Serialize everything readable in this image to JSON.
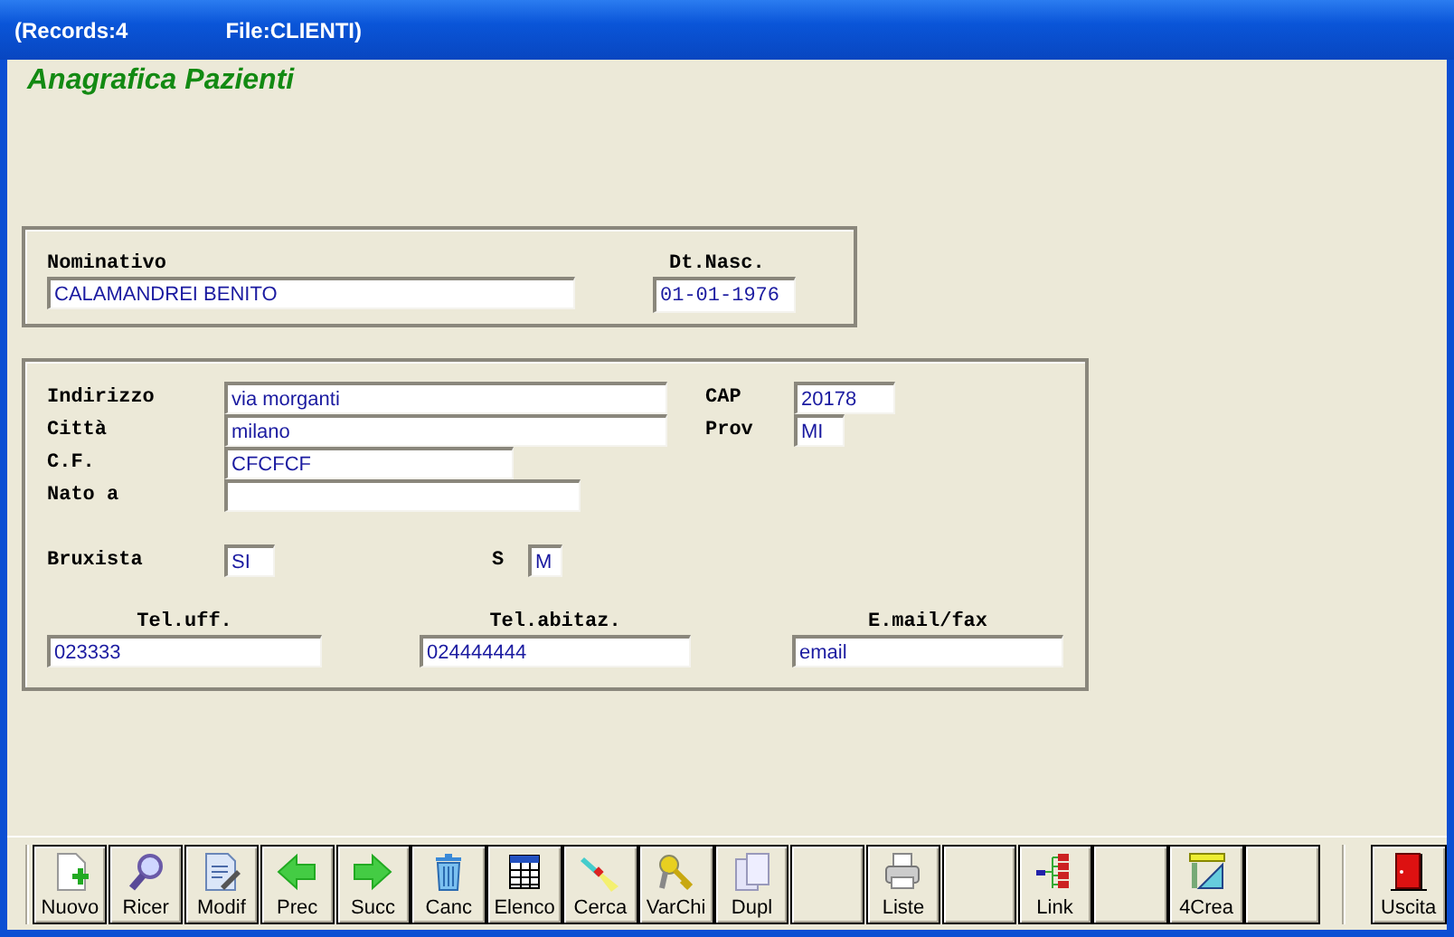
{
  "window": {
    "title_records": "(Records:4",
    "title_file": "File:CLIENTI)"
  },
  "form_title": "Anagrafica Pazienti",
  "name_panel": {
    "fields": [
      {
        "label": "Nominativo",
        "value": "CALAMANDREI BENITO"
      },
      {
        "label": "Dt.Nasc.",
        "value": "01-01-1976"
      }
    ]
  },
  "address_panel": {
    "fields": [
      {
        "label": "Indirizzo",
        "value": "via morganti"
      },
      {
        "label": "CAP",
        "value": "20178"
      },
      {
        "label": "Città",
        "value": "milano"
      },
      {
        "label": "Prov",
        "value": "MI"
      },
      {
        "label": "C.F.",
        "value": "CFCFCF"
      },
      {
        "label": "Nato a"
      },
      {
        "label": "Bruxista",
        "value": "SI"
      },
      {
        "label": "S",
        "value": "M"
      },
      {
        "label": "Tel.uff.",
        "value": "023333"
      },
      {
        "label": "Tel.abitaz.",
        "value": "024444444"
      },
      {
        "label": "E.mail/fax",
        "value": "email"
      }
    ]
  },
  "toolbar": [
    {
      "kind": "new",
      "label": "Nuovo"
    },
    {
      "kind": "search",
      "label": "Ricer"
    },
    {
      "kind": "edit",
      "label": "Modif"
    },
    {
      "kind": "prev",
      "label": "Prec"
    },
    {
      "kind": "next",
      "label": "Succ"
    },
    {
      "kind": "delete",
      "label": "Canc"
    },
    {
      "kind": "list",
      "label": "Elenco"
    },
    {
      "kind": "find",
      "label": "Cerca"
    },
    {
      "kind": "keys",
      "label": "VarChi"
    },
    {
      "kind": "duplicate",
      "label": "Dupl"
    },
    {
      "kind": "blank"
    },
    {
      "kind": "print",
      "label": "Liste"
    },
    {
      "kind": "blank"
    },
    {
      "kind": "link",
      "label": "Link"
    },
    {
      "kind": "blank"
    },
    {
      "kind": "create",
      "label": "4Crea"
    },
    {
      "kind": "blank"
    },
    {
      "kind": "exit",
      "label": "Uscita"
    }
  ]
}
